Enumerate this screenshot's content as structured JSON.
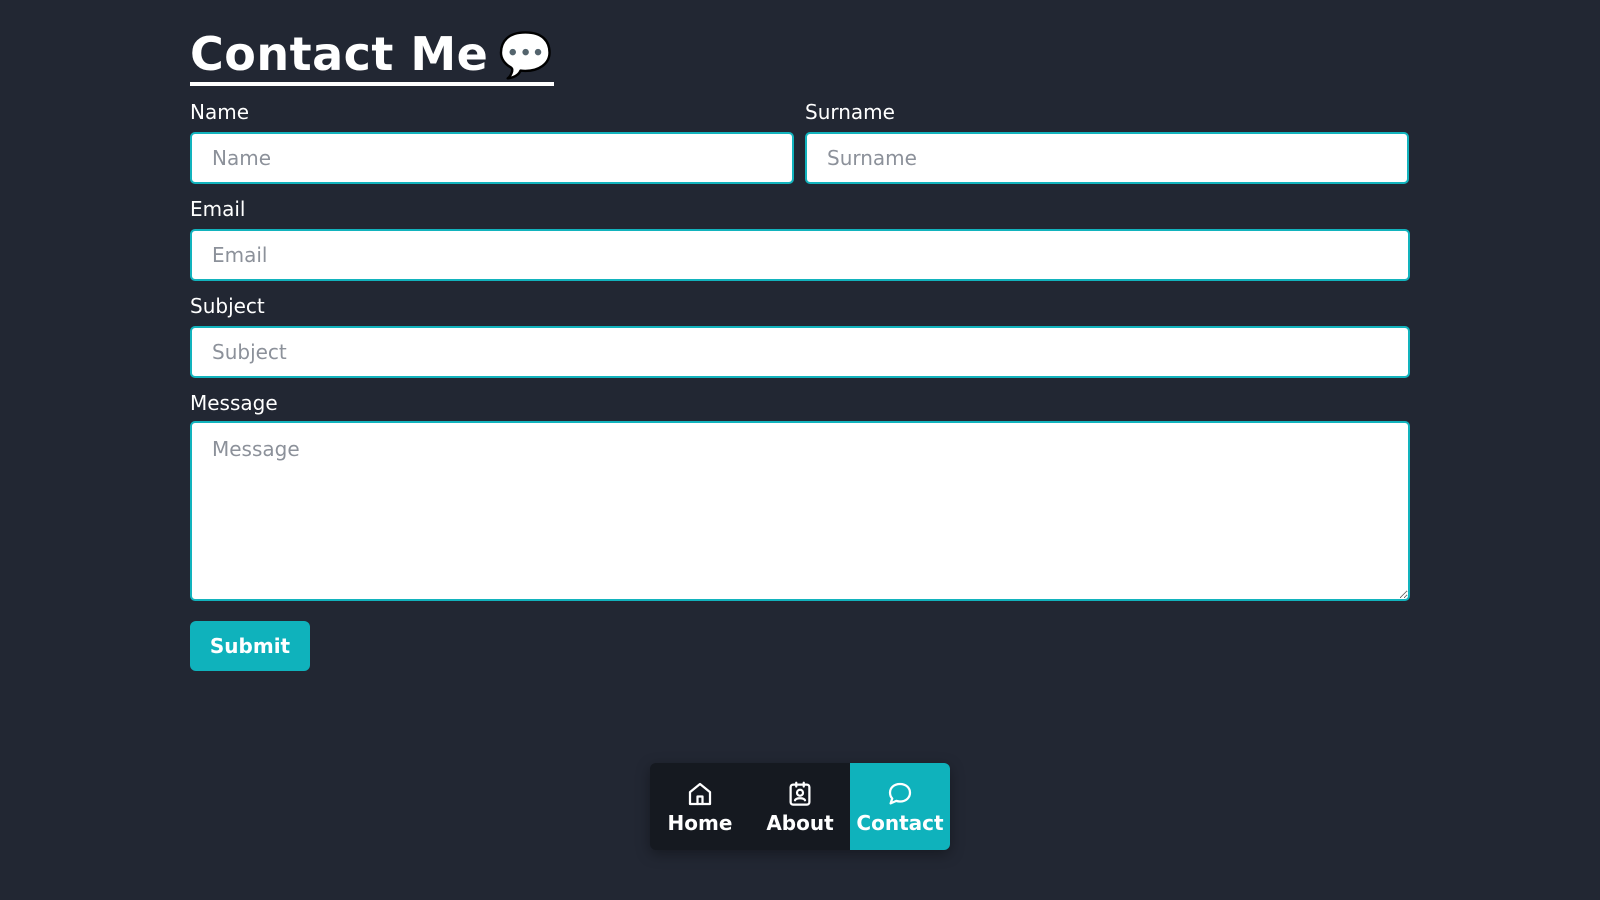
{
  "header": {
    "title": "Contact Me",
    "title_emoji": "💬"
  },
  "form": {
    "name": {
      "label": "Name",
      "placeholder": "Name",
      "value": ""
    },
    "surname": {
      "label": "Surname",
      "placeholder": "Surname",
      "value": ""
    },
    "email": {
      "label": "Email",
      "placeholder": "Email",
      "value": ""
    },
    "subject": {
      "label": "Subject",
      "placeholder": "Subject",
      "value": ""
    },
    "message": {
      "label": "Message",
      "placeholder": "Message",
      "value": ""
    },
    "submit_label": "Submit"
  },
  "nav": {
    "items": [
      {
        "label": "Home",
        "icon": "home-icon",
        "active": false
      },
      {
        "label": "About",
        "icon": "contact-card-icon",
        "active": false
      },
      {
        "label": "Contact",
        "icon": "chat-bubble-icon",
        "active": true
      }
    ]
  },
  "colors": {
    "background": "#222733",
    "accent": "#0fb2bc",
    "navbar": "#151920",
    "input_border": "#12b3bd"
  }
}
